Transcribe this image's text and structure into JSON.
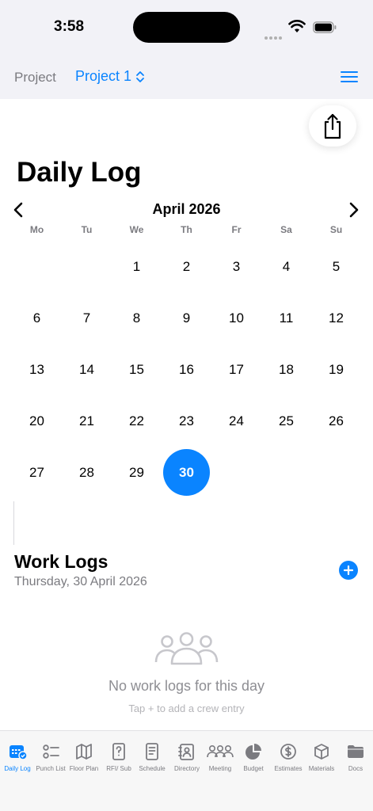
{
  "status": {
    "time": "3:58"
  },
  "nav": {
    "label": "Project",
    "project": "Project 1"
  },
  "page": {
    "title": "Daily Log"
  },
  "calendar": {
    "month": "April 2026",
    "weekdays": [
      "Mo",
      "Tu",
      "We",
      "Th",
      "Fr",
      "Sa",
      "Su"
    ],
    "leading_blanks": 2,
    "days": [
      "1",
      "2",
      "3",
      "4",
      "5",
      "6",
      "7",
      "8",
      "9",
      "10",
      "11",
      "12",
      "13",
      "14",
      "15",
      "16",
      "17",
      "18",
      "19",
      "20",
      "21",
      "22",
      "23",
      "24",
      "25",
      "26",
      "27",
      "28",
      "29",
      "30"
    ],
    "selected": "30"
  },
  "work_logs": {
    "title": "Work Logs",
    "date": "Thursday, 30 April 2026",
    "empty_title": "No work logs for this day",
    "empty_hint": "Tap + to add a crew entry"
  },
  "tabs": [
    {
      "label": "Daily Log",
      "icon": "calendar-icon",
      "active": true
    },
    {
      "label": "Punch List",
      "icon": "checklist-icon",
      "active": false
    },
    {
      "label": "Floor Plan",
      "icon": "map-icon",
      "active": false
    },
    {
      "label": "RFI/ Sub",
      "icon": "question-doc-icon",
      "active": false
    },
    {
      "label": "Schedule",
      "icon": "document-icon",
      "active": false
    },
    {
      "label": "Directory",
      "icon": "contact-book-icon",
      "active": false
    },
    {
      "label": "Meeting",
      "icon": "people-icon",
      "active": false
    },
    {
      "label": "Budget",
      "icon": "pie-chart-icon",
      "active": false
    },
    {
      "label": "Estimates",
      "icon": "dollar-circle-icon",
      "active": false
    },
    {
      "label": "Materials",
      "icon": "box-icon",
      "active": false
    },
    {
      "label": "Docs",
      "icon": "folder-icon",
      "active": false
    }
  ],
  "colors": {
    "accent": "#0a84ff",
    "secondary_text": "#7b7b80",
    "background": "#f2f2f7"
  }
}
